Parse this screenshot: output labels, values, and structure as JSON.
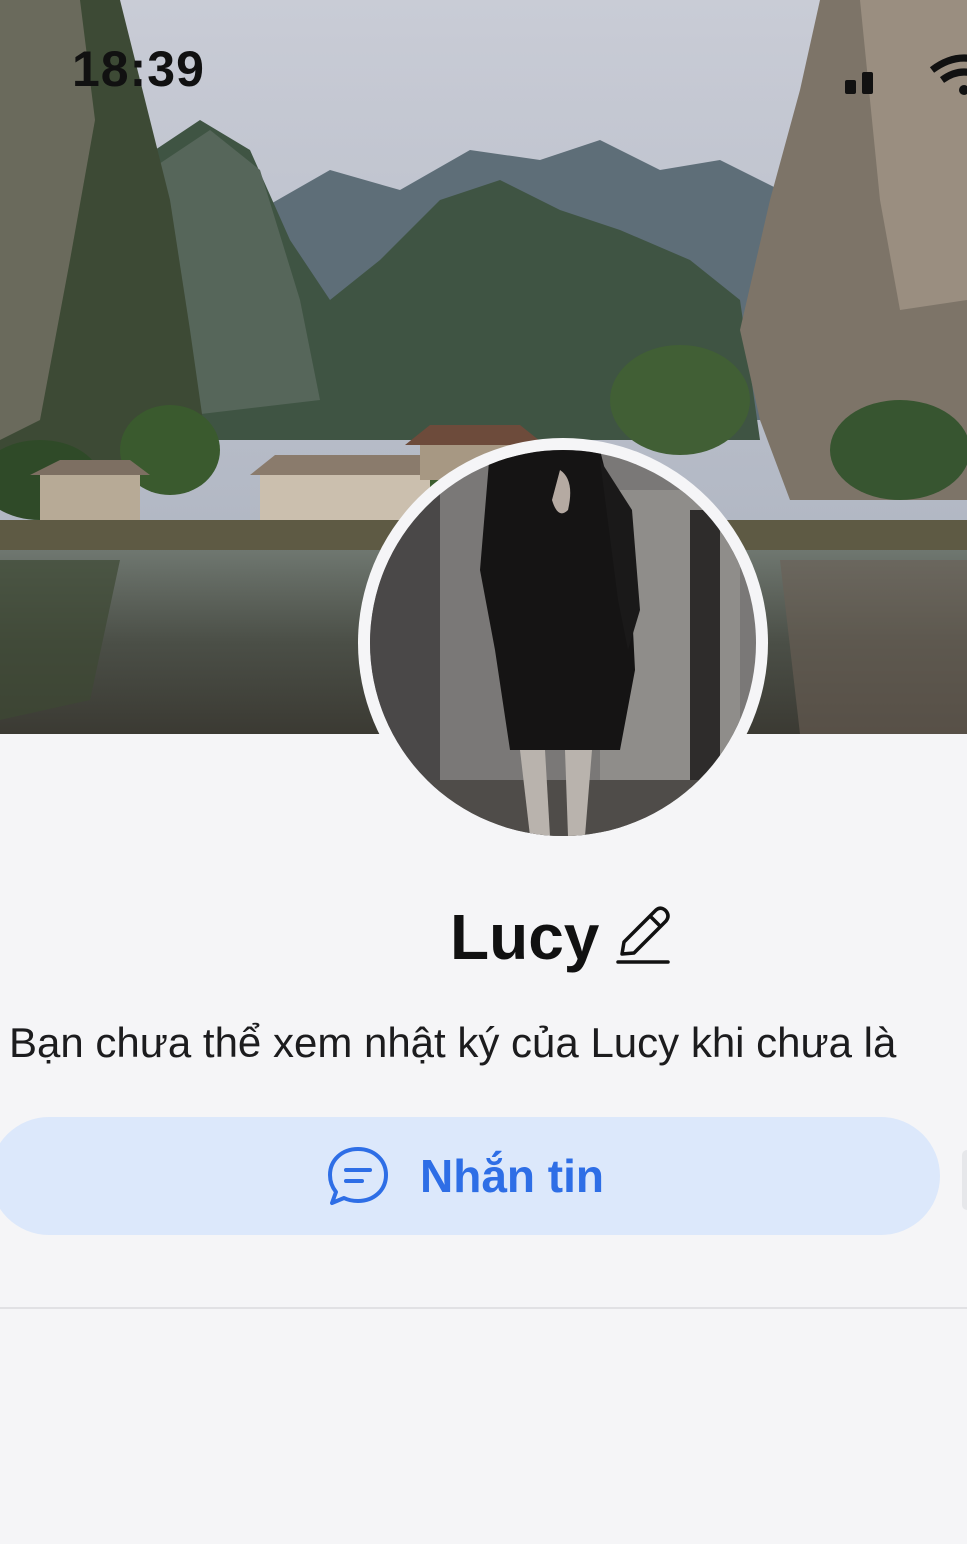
{
  "status_bar": {
    "time": "18:39",
    "icons": [
      "signal-icon",
      "wifi-icon"
    ]
  },
  "cover_photo": {
    "alt_subject": "karst-mountains-lake-village"
  },
  "avatar": {
    "subject": "profile-photo"
  },
  "profile": {
    "name": "Lucy",
    "edit_icon": "pencil-icon",
    "notice": "Bạn chưa thể xem nhật ký của Lucy khi chưa là"
  },
  "actions": {
    "message_label": "Nhắn tin",
    "message_icon": "chat-bubble-icon"
  },
  "colors": {
    "background": "#f5f5f7",
    "accent": "#2e6ee6",
    "button_bg": "#dce8fb"
  }
}
